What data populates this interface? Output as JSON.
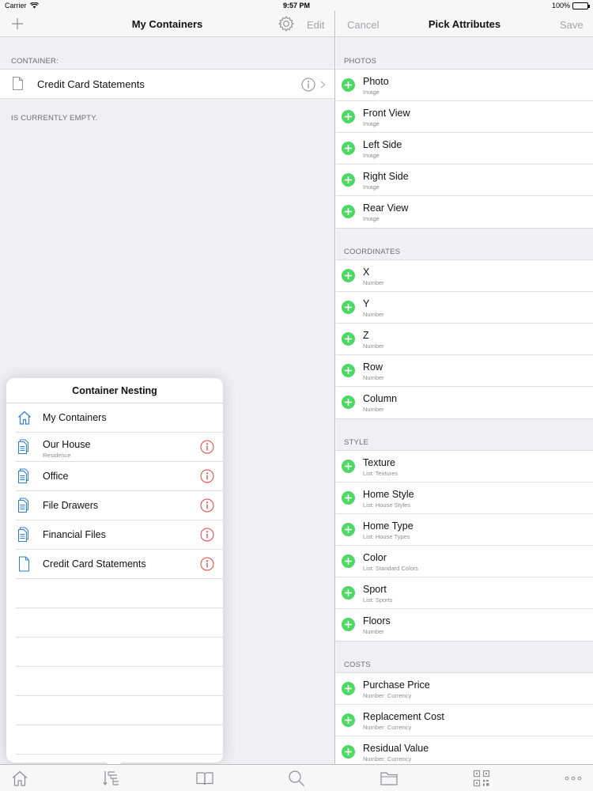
{
  "status_bar": {
    "carrier": "Carrier",
    "time": "9:57 PM",
    "battery": "100%"
  },
  "left": {
    "nav_title": "My Containers",
    "edit_label": "Edit",
    "container_section": "CONTAINER:",
    "container_name": "Credit Card Statements",
    "empty_note": "IS CURRENTLY EMPTY."
  },
  "popover": {
    "title": "Container Nesting",
    "items": [
      {
        "label": "My Containers",
        "sub": "",
        "icon": "house-icon",
        "info": false
      },
      {
        "label": "Our House",
        "sub": "Residence",
        "icon": "stacked-documents-icon",
        "info": true
      },
      {
        "label": "Office",
        "sub": "",
        "icon": "stacked-documents-icon",
        "info": true
      },
      {
        "label": "File Drawers",
        "sub": "",
        "icon": "stacked-documents-icon",
        "info": true
      },
      {
        "label": "Financial Files",
        "sub": "",
        "icon": "stacked-documents-icon",
        "info": true
      },
      {
        "label": "Credit Card Statements",
        "sub": "",
        "icon": "document-icon",
        "info": true
      }
    ]
  },
  "right": {
    "cancel_label": "Cancel",
    "nav_title": "Pick Attributes",
    "save_label": "Save",
    "sections": [
      {
        "title": "PHOTOS",
        "items": [
          {
            "name": "Photo",
            "type": "Image"
          },
          {
            "name": "Front View",
            "type": "Image"
          },
          {
            "name": "Left Side",
            "type": "Image"
          },
          {
            "name": "Right Side",
            "type": "Image"
          },
          {
            "name": "Rear View",
            "type": "Image"
          }
        ]
      },
      {
        "title": "COORDINATES",
        "items": [
          {
            "name": "X",
            "type": "Number"
          },
          {
            "name": "Y",
            "type": "Number"
          },
          {
            "name": "Z",
            "type": "Number"
          },
          {
            "name": "Row",
            "type": "Number"
          },
          {
            "name": "Column",
            "type": "Number"
          }
        ]
      },
      {
        "title": "STYLE",
        "items": [
          {
            "name": "Texture",
            "type": "List: Textures"
          },
          {
            "name": "Home Style",
            "type": "List: House Styles"
          },
          {
            "name": "Home Type",
            "type": "List: House Types"
          },
          {
            "name": "Color",
            "type": "List: Standard Colors"
          },
          {
            "name": "Sport",
            "type": "List: Sports"
          },
          {
            "name": "Floors",
            "type": "Number"
          }
        ]
      },
      {
        "title": "COSTS",
        "items": [
          {
            "name": "Purchase Price",
            "type": "Number: Currency"
          },
          {
            "name": "Replacement Cost",
            "type": "Number: Currency"
          },
          {
            "name": "Residual Value",
            "type": "Number: Currency"
          }
        ]
      }
    ]
  },
  "tab_bar": [
    {
      "icon": "home-icon"
    },
    {
      "icon": "nesting-icon"
    },
    {
      "icon": "book-icon"
    },
    {
      "icon": "search-icon"
    },
    {
      "icon": "folder-icon"
    },
    {
      "icon": "qr-code-icon"
    },
    {
      "icon": "more-icon"
    }
  ],
  "colors": {
    "accent_green": "#4cd964",
    "info_red": "#e0403c",
    "icon_blue": "#2f7fd6",
    "muted_gray": "#8e8e93"
  }
}
